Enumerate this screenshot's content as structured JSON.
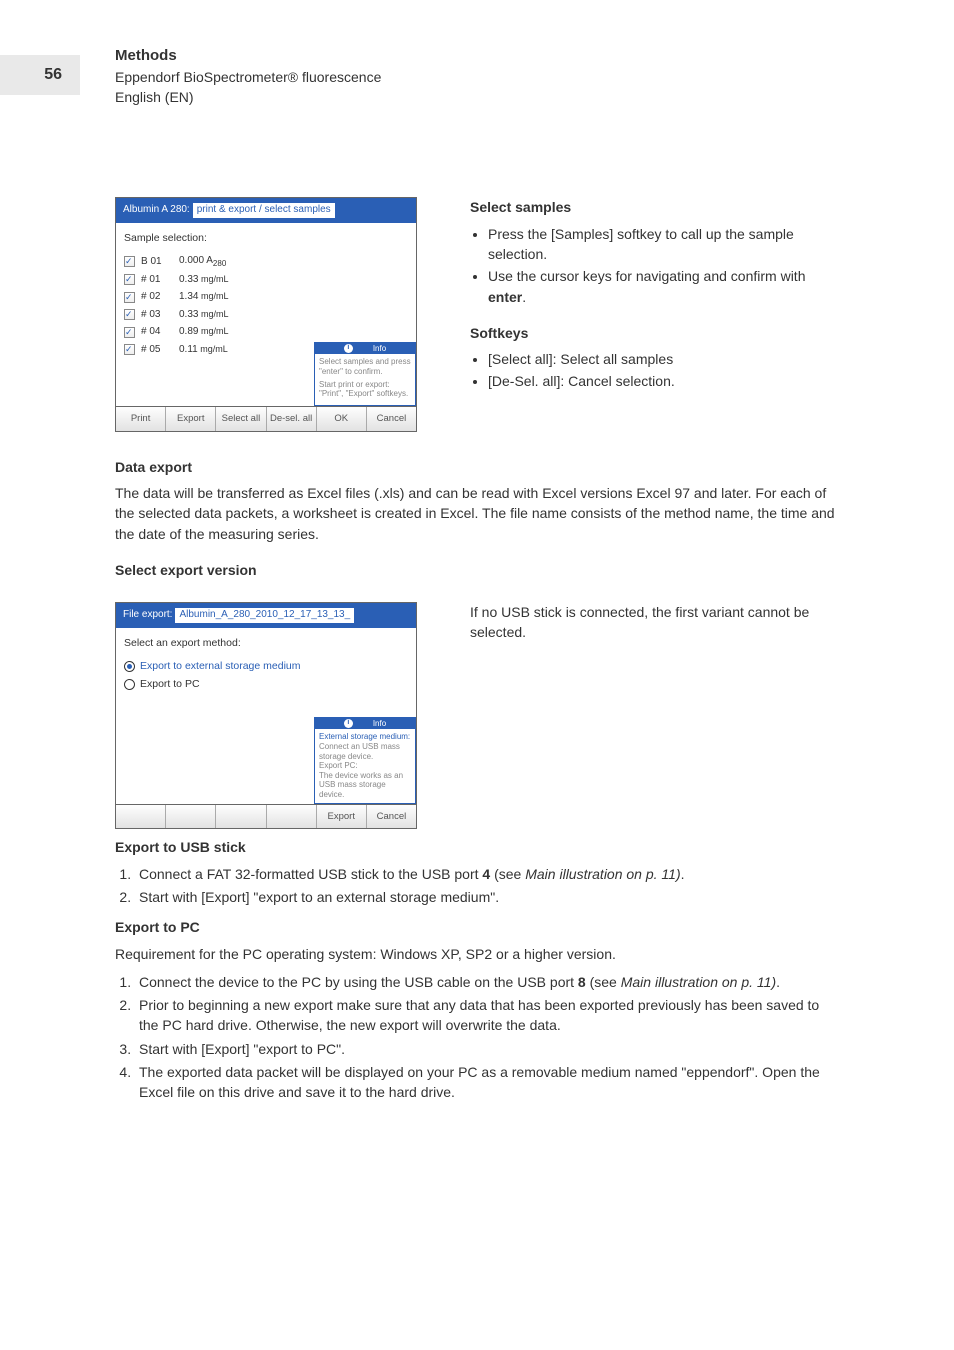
{
  "page_number": "56",
  "header": {
    "title": "Methods",
    "product": "Eppendorf BioSpectrometer® fluorescence",
    "lang": "English (EN)"
  },
  "screen1": {
    "header_main": "Albumin A 280:",
    "header_path": "print & export / select samples",
    "subtitle": "Sample selection:",
    "samples": [
      {
        "id": "B 01",
        "val": "0.000 A",
        "sub": "280",
        "unit": ""
      },
      {
        "id": "# 01",
        "val": "0.33",
        "sub": "",
        "unit": "mg/mL"
      },
      {
        "id": "# 02",
        "val": "1.34",
        "sub": "",
        "unit": "mg/mL"
      },
      {
        "id": "# 03",
        "val": "0.33",
        "sub": "",
        "unit": "mg/mL"
      },
      {
        "id": "# 04",
        "val": "0.89",
        "sub": "",
        "unit": "mg/mL"
      },
      {
        "id": "# 05",
        "val": "0.11",
        "sub": "",
        "unit": "mg/mL"
      }
    ],
    "info_title": "Info",
    "info_line1": "Select samples and press \"enter\" to confirm.",
    "info_line2": "Start print or export: \"Print\", \"Export\" softkeys.",
    "softkeys": [
      "Print",
      "Export",
      "Select all",
      "De-sel. all",
      "OK",
      "Cancel"
    ]
  },
  "right1": {
    "h1": "Select samples",
    "b1": "Press the [Samples] softkey to call up the sample selection.",
    "b2a": "Use the cursor keys for navigating and confirm with ",
    "b2b": "enter",
    "b2c": ".",
    "h2": "Softkeys",
    "b3": "[Select all]: Select all samples",
    "b4": "[De-Sel. all]: Cancel selection."
  },
  "sec2": {
    "h": "Data export",
    "p": "The data will be transferred as Excel files (.xls) and can be read with Excel versions Excel 97 and later. For each of the selected data packets, a worksheet is created in Excel. The file name consists of the method name, the time and the date of the measuring series."
  },
  "sec3_h": "Select export version",
  "screen2": {
    "header_main": "File export:",
    "header_path": "Albumin_A_280_2010_12_17_13_13_",
    "subtitle": "Select an export method:",
    "opt1": "Export to external storage medium",
    "opt2": "Export to PC",
    "info_title": "Info",
    "info_l1": "External storage medium:",
    "info_l2": "Connect an USB mass storage device.",
    "info_l3": "Export PC:",
    "info_l4": "The device works as an USB mass storage device.",
    "softkeys": [
      "",
      "",
      "",
      "",
      "Export",
      "Cancel"
    ]
  },
  "right2": {
    "p": "If no USB stick is connected, the first variant cannot be selected."
  },
  "sec4": {
    "h1": "Export to USB stick",
    "o1a": "Connect a FAT 32-formatted USB stick to the USB port ",
    "o1b": "4",
    "o1c": " (see ",
    "o1d": "Main illustration on p. 11)",
    "o1e": ".",
    "o2": "Start with [Export] \"export to an external storage medium\".",
    "h2": "Export to PC",
    "req": "Requirement for the PC operating system: Windows XP, SP2 or a higher version.",
    "p1a": "Connect the device to the PC by using the USB cable on the USB port ",
    "p1b": "8",
    "p1c": " (see ",
    "p1d": "Main illustration on p. 11)",
    "p1e": ".",
    "p2": "Prior to beginning a new export make sure that any data that has been exported previously has been saved to the PC hard drive. Otherwise, the new export will overwrite the data.",
    "p3": "Start with [Export] \"export to PC\".",
    "p4": "The exported data packet will be displayed on your PC as a removable medium named \"eppendorf\". Open the Excel file on this drive and save it to the hard drive."
  }
}
